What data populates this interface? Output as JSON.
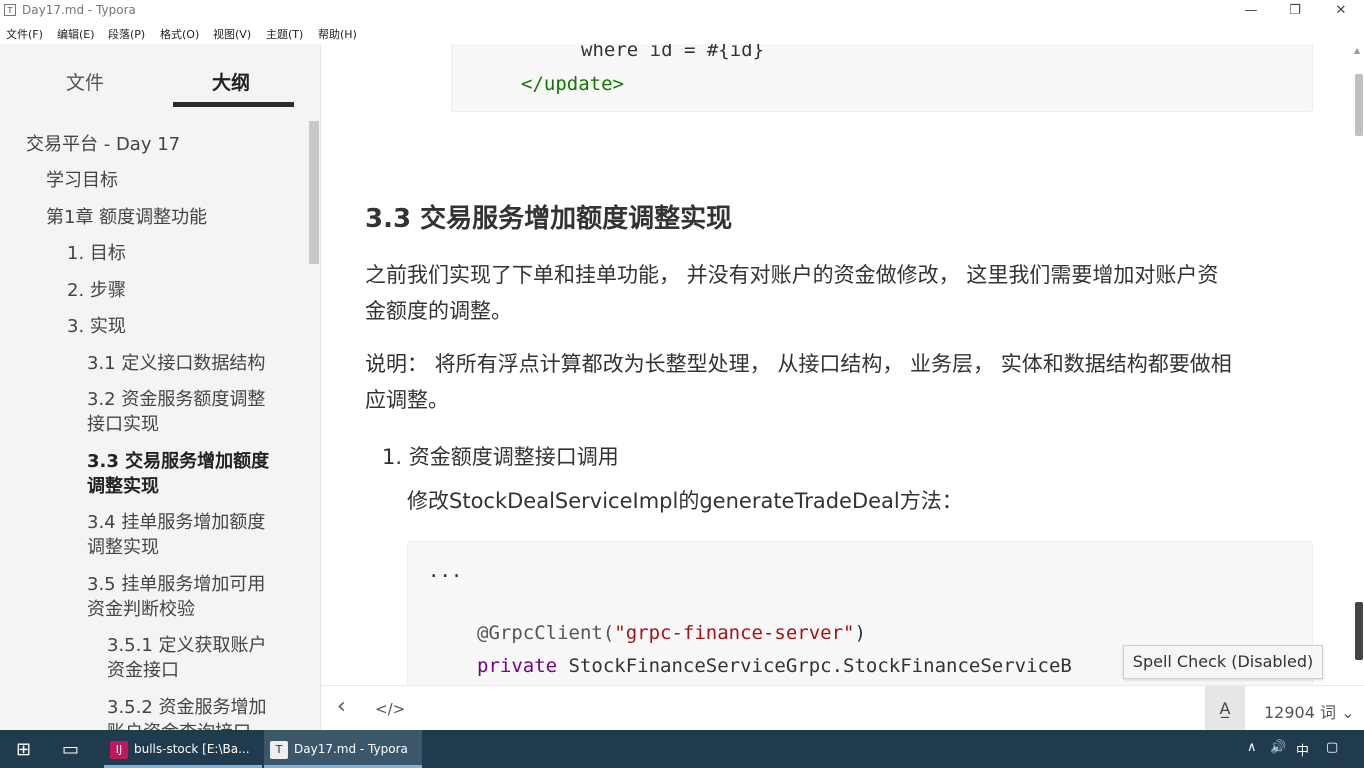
{
  "window": {
    "title": "Day17.md - Typora",
    "icon_letter": "T",
    "minimize": "—",
    "restore": "❐",
    "close": "✕"
  },
  "menu": [
    "文件(F)",
    "编辑(E)",
    "段落(P)",
    "格式(O)",
    "视图(V)",
    "主题(T)",
    "帮助(H)"
  ],
  "sidebar": {
    "tabs": [
      "文件",
      "大纲"
    ],
    "active_tab": "大纲",
    "outline": [
      {
        "text": "交易平台 - Day 17",
        "level": 0
      },
      {
        "text": "学习目标",
        "level": 1
      },
      {
        "text": "第1章 额度调整功能",
        "level": 1
      },
      {
        "text": "1. 目标",
        "level": 2
      },
      {
        "text": "2. 步骤",
        "level": 2
      },
      {
        "text": "3. 实现",
        "level": 2
      },
      {
        "text": "3.1 定义接口数据结构",
        "level": 3
      },
      {
        "text": "3.2 资金服务额度调整",
        "text2": "接口实现",
        "level": 3
      },
      {
        "text": "3.3 交易服务增加额度",
        "text2": "调整实现",
        "level": 3,
        "active": true
      },
      {
        "text": "3.4 挂单服务增加额度",
        "text2": "调整实现",
        "level": 3
      },
      {
        "text": "3.5 挂单服务增加可用",
        "text2": "资金判断校验",
        "level": 3
      },
      {
        "text": "3.5.1 定义获取账户",
        "text2": "资金接口",
        "level": 4
      },
      {
        "text": "3.5.2 资金服务增加",
        "text2": "账户资金查询接口",
        "level": 4
      }
    ]
  },
  "editor": {
    "code_top": {
      "line1": "where id = #{id}",
      "line2": "</update>"
    },
    "heading": "3.3  交易服务增加额度调整实现",
    "para1_line1": "之前我们实现了下单和挂单功能， 并没有对账户的资金做修改， 这里我们需要增加对账户资",
    "para1_line2": "金额度的调整。",
    "para2_line1": "说明： 将所有浮点计算都改为长整型处理， 从接口结构， 业务层， 实体和数据结构都要做相",
    "para2_line2": "应调整。",
    "list_item": "1. 资金额度调整接口调用",
    "list_para": "修改StockDealServiceImpl的generateTradeDeal方法：",
    "code_main": {
      "line1": "...",
      "anno": "@GrpcClient(",
      "anno_str": "\"grpc-finance-server\"",
      "anno_close": ")",
      "kw": "private",
      "rest": " StockFinanceServiceGrpc.StockFinanceServiceB"
    }
  },
  "tooltip": "Spell Check (Disabled)",
  "statusbar": {
    "back": "‹",
    "source": "</>",
    "spell_icon": "A̲",
    "word_count": "12904 词",
    "dropdown": "⌄"
  },
  "taskbar": {
    "start": "⊞",
    "taskview": "▭",
    "apps": [
      {
        "label": "bulls-stock [E:\\Ba...",
        "badge": "IJ"
      },
      {
        "label": "Day17.md - Typora",
        "badge": "T"
      }
    ],
    "tray": {
      "chevron": "∧",
      "volume": "🔊",
      "ime": "中",
      "notify": "▢"
    }
  }
}
